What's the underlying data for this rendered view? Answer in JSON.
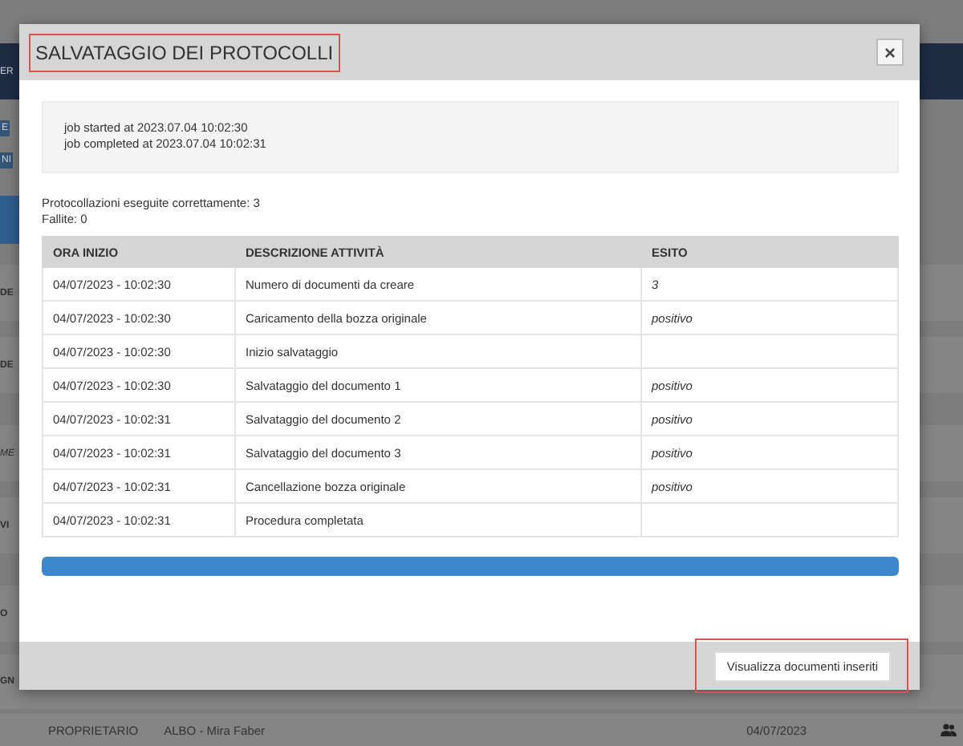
{
  "background": {
    "left_fragments": [
      {
        "kind": "bar",
        "text": "ER"
      },
      {
        "kind": "button",
        "text": "E"
      },
      {
        "kind": "button",
        "text": "NI"
      },
      {
        "kind": "heading",
        "text": "DE"
      },
      {
        "kind": "heading",
        "text": "DE"
      },
      {
        "kind": "label",
        "text": "ME"
      },
      {
        "kind": "heading",
        "text": "VI"
      },
      {
        "kind": "heading",
        "text": "O"
      },
      {
        "kind": "heading",
        "text": "GN"
      }
    ],
    "bottom_row": {
      "role": "PROPRIETARIO",
      "name": "ALBO - Mira Faber",
      "date": "04/07/2023"
    }
  },
  "dialog": {
    "title": "SALVATAGGIO DEI PROTOCOLLI",
    "close": "×",
    "log": [
      "job started at 2023.07.04 10:02:30",
      "job completed at 2023.07.04 10:02:31"
    ],
    "summary": [
      "Protocollazioni eseguite correttamente: 3",
      "Fallite: 0"
    ],
    "table": {
      "columns": [
        "ORA INIZIO",
        "DESCRIZIONE ATTIVITÀ",
        "ESITO"
      ],
      "rows": [
        {
          "time": "04/07/2023 - 10:02:30",
          "activity": "Numero di documenti da creare",
          "result": "3"
        },
        {
          "time": "04/07/2023 - 10:02:30",
          "activity": "Caricamento della bozza originale",
          "result": "positivo"
        },
        {
          "time": "04/07/2023 - 10:02:30",
          "activity": "Inizio salvataggio"
        },
        {
          "time": "04/07/2023 - 10:02:30",
          "activity": "Salvataggio del documento 1",
          "result": "positivo"
        },
        {
          "time": "04/07/2023 - 10:02:31",
          "activity": "Salvataggio del documento 2",
          "result": "positivo"
        },
        {
          "time": "04/07/2023 - 10:02:31",
          "activity": "Salvataggio del documento 3",
          "result": "positivo"
        },
        {
          "time": "04/07/2023 - 10:02:31",
          "activity": "Cancellazione bozza originale",
          "result": "positivo"
        },
        {
          "time": "04/07/2023 - 10:02:31",
          "activity": "Procedura completata"
        }
      ]
    },
    "progress": {
      "level": 1
    },
    "footer_button": "Visualizza documenti inseriti"
  }
}
